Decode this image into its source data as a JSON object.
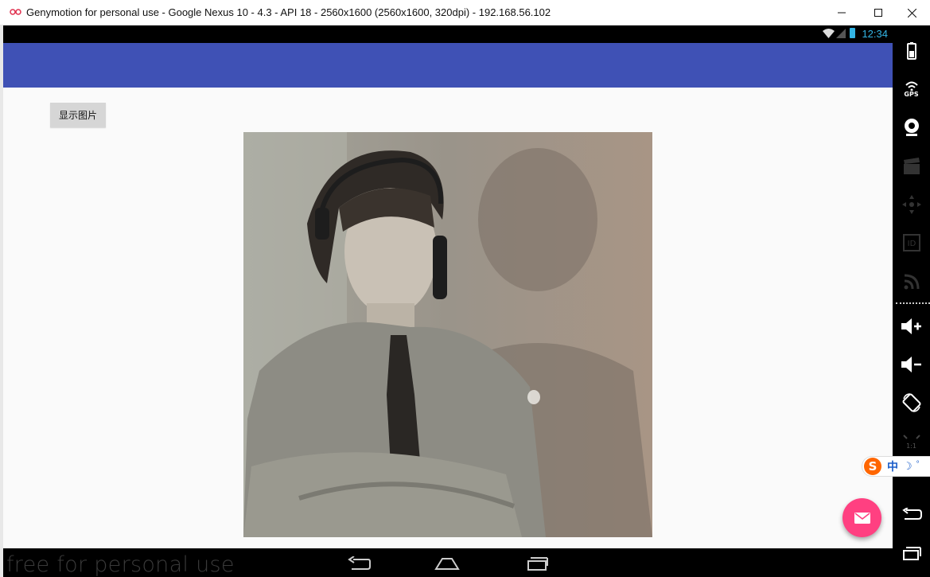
{
  "window": {
    "title": "Genymotion for personal use - Google Nexus 10 - 4.3 - API 18 - 2560x1600 (2560x1600, 320dpi) - 192.168.56.102",
    "controls": [
      "minimize-icon",
      "maximize-icon",
      "close-icon"
    ]
  },
  "statusbar": {
    "clock": "12:34",
    "icons": [
      "wifi-icon",
      "signal-icon",
      "battery-icon"
    ],
    "accent": "#33b5e5"
  },
  "app": {
    "appbar_color": "#3f51b5",
    "show_image_button": "显示图片",
    "image_description_icon": "photo",
    "fab_icon": "mail-icon",
    "fab_color": "#ff4081"
  },
  "navbar": {
    "watermark": "free for personal use",
    "buttons": [
      "back-icon",
      "home-icon",
      "recent-apps-icon"
    ]
  },
  "sidebar": {
    "gps_label": "GPS",
    "ratio_label": "1:1",
    "items": [
      "battery-icon",
      "gps-icon",
      "webcam-icon",
      "video-capture-icon",
      "dpad-icon",
      "device-id-icon",
      "rss-icon",
      "volume-up-icon",
      "volume-down-icon",
      "rotate-icon",
      "pixel-perfect-icon",
      "back-icon",
      "recent-apps-icon"
    ]
  },
  "ime": {
    "logo": "S",
    "lang": "中",
    "moon": "☽",
    "degree": "°"
  }
}
